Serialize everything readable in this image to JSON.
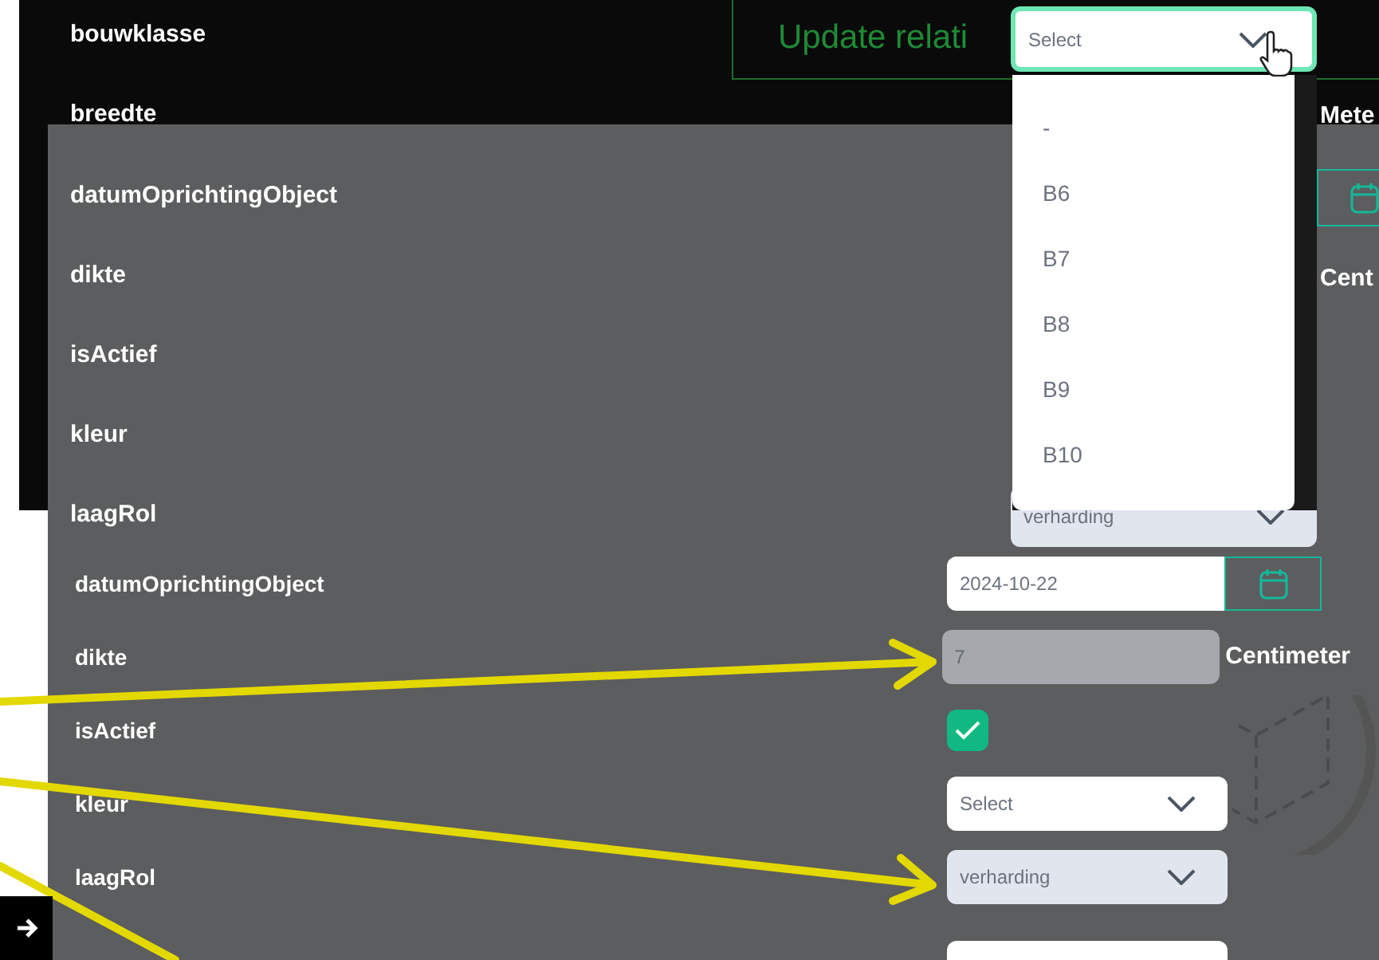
{
  "back_screen": {
    "labels": [
      "bouwklasse",
      "breedte"
    ],
    "update_button": "Update relati"
  },
  "bouwklasse_select": {
    "placeholder": "Select",
    "expanded": true
  },
  "dropdown_options": [
    "-",
    "B6",
    "B7",
    "B8",
    "B9",
    "B10"
  ],
  "upper_form": {
    "labels": [
      "datumOprichtingObject",
      "dikte",
      "isActief",
      "kleur",
      "laagRol"
    ],
    "units": [
      "Mete",
      "Cent"
    ],
    "laagrol_value": "verharding"
  },
  "lower_form": [
    {
      "label": "datumOprichtingObject",
      "kind": "date",
      "value": "2024-10-22"
    },
    {
      "label": "dikte",
      "kind": "input",
      "value": "7",
      "unit": "Centimeter",
      "disabled": true
    },
    {
      "label": "isActief",
      "kind": "checkbox",
      "checked": true
    },
    {
      "label": "kleur",
      "kind": "select",
      "placeholder": "Select",
      "disabled": false
    },
    {
      "label": "laagRol",
      "kind": "select",
      "value": "verharding",
      "disabled": true
    }
  ]
}
